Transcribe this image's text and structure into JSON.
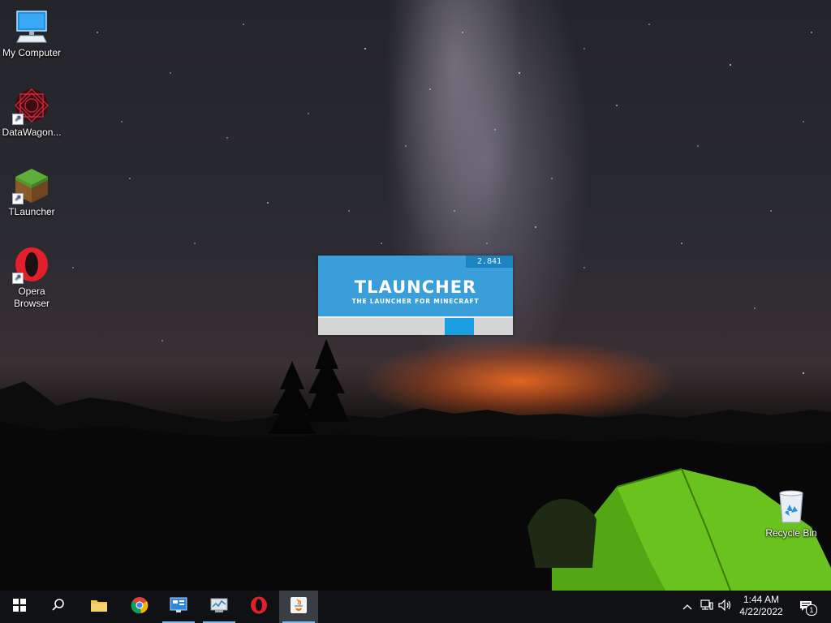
{
  "desktop": {
    "icons": [
      {
        "label": "My Computer",
        "icon": "computer-monitor-icon",
        "shortcut": false
      },
      {
        "label": "DataWagon...",
        "icon": "datawagon-icon",
        "shortcut": true
      },
      {
        "label": "TLauncher",
        "icon": "minecraft-grass-block-icon",
        "shortcut": true
      },
      {
        "label": "Opera Browser",
        "icon": "opera-logo-icon",
        "shortcut": true
      },
      {
        "label": "Recycle Bin",
        "icon": "recycle-bin-icon",
        "shortcut": false
      }
    ]
  },
  "splash": {
    "version": "2.841",
    "title": "TLAUNCHER",
    "subtitle": "THE LAUNCHER FOR MINECRAFT",
    "progress_indicator": "indeterminate",
    "colors": {
      "background": "#3a9edb",
      "progress": "#1b9de2",
      "track": "#d4d6d6"
    }
  },
  "taskbar": {
    "buttons": [
      {
        "name": "start",
        "icon": "windows-logo-icon"
      },
      {
        "name": "search",
        "icon": "search-icon"
      },
      {
        "name": "file-explorer",
        "icon": "folder-icon"
      },
      {
        "name": "chrome",
        "icon": "chrome-icon"
      },
      {
        "name": "control-panel",
        "icon": "control-panel-icon",
        "running": true
      },
      {
        "name": "task-manager",
        "icon": "task-manager-icon",
        "running": true
      },
      {
        "name": "opera",
        "icon": "opera-logo-icon"
      },
      {
        "name": "java-tlauncher",
        "icon": "java-icon",
        "running": true,
        "active": true
      }
    ],
    "tray": {
      "icons": [
        "chevron-up-icon",
        "network-icon",
        "volume-icon"
      ],
      "time": "1:44 AM",
      "date": "4/22/2022",
      "notification_count": "1"
    }
  }
}
